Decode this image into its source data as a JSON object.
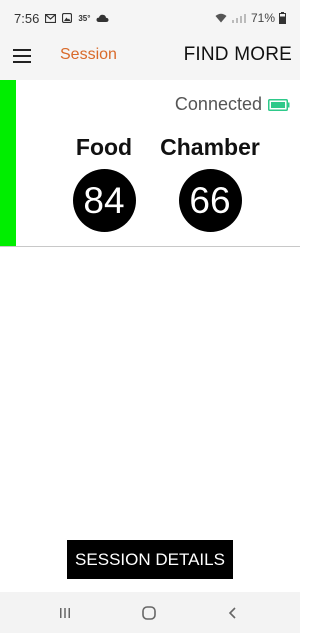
{
  "status_bar": {
    "time": "7:56",
    "temperature": "35°",
    "battery_percent": "71%",
    "icons": [
      "gmail-icon",
      "gallery-icon",
      "cloud-icon",
      "wifi-icon",
      "signal-icon",
      "battery-icon"
    ]
  },
  "app_bar": {
    "menu_icon": "hamburger-menu-icon",
    "title": "Session",
    "find_more_label": "FIND MORE"
  },
  "session": {
    "connection_status": "Connected",
    "status_color": "#00ee00",
    "battery_color": "#2ec98a",
    "probes": [
      {
        "label": "Food",
        "value": "84"
      },
      {
        "label": "Chamber",
        "value": "66"
      }
    ]
  },
  "actions": {
    "session_details_label": "SESSION DETAILS"
  },
  "nav_bar": {
    "icons": [
      "recents-icon",
      "home-icon",
      "back-icon"
    ]
  },
  "colors": {
    "accent": "#d96a2a"
  }
}
